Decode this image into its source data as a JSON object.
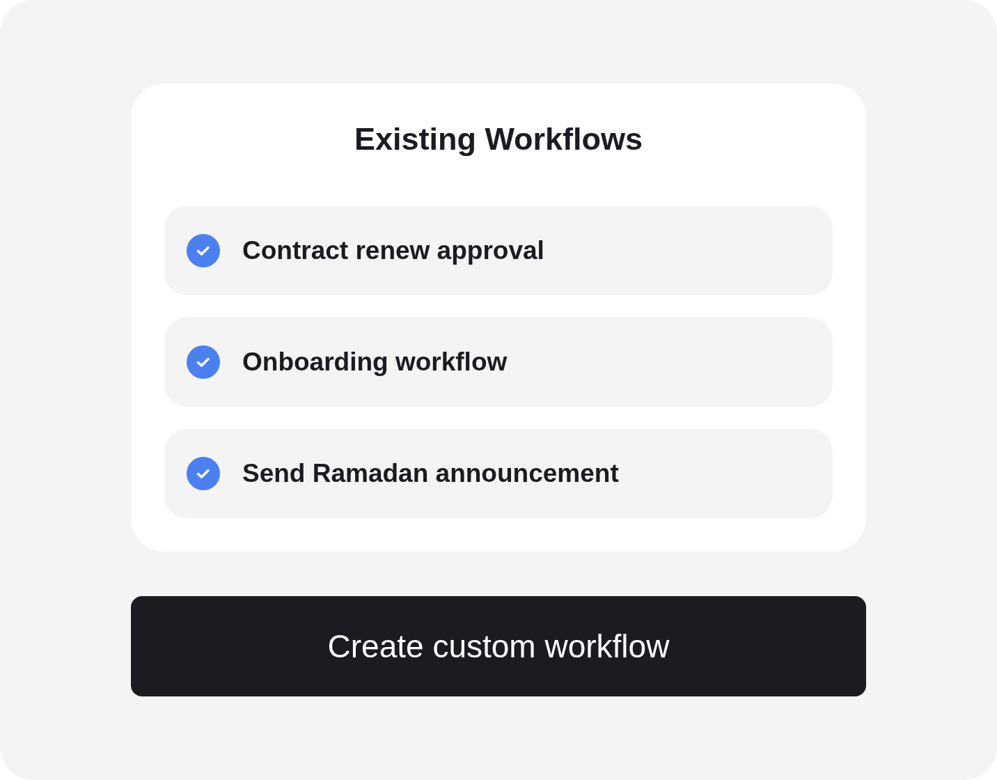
{
  "card": {
    "title": "Existing Workflows",
    "workflows": [
      {
        "label": "Contract renew approval",
        "checked": true
      },
      {
        "label": "Onboarding workflow",
        "checked": true
      },
      {
        "label": "Send Ramadan announcement",
        "checked": true
      }
    ]
  },
  "create_button": {
    "label": "Create custom workflow"
  }
}
